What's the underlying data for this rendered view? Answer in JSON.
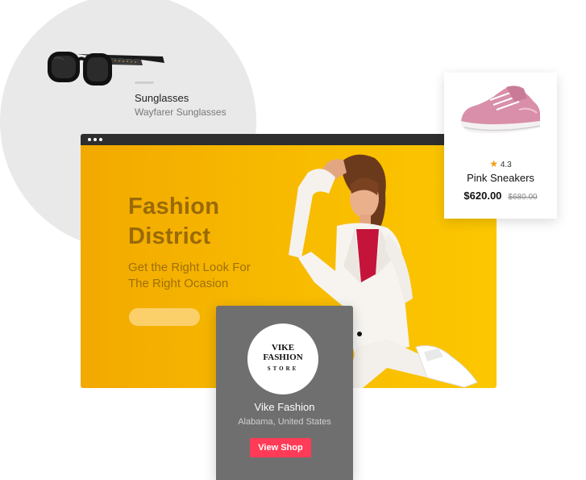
{
  "sunglasses_card": {
    "title": "Sunglasses",
    "subtitle": "Wayfarer Sunglasses"
  },
  "hero": {
    "title_line1": "Fashion",
    "title_line2": "District",
    "subtitle_line1": "Get the Right Look For",
    "subtitle_line2": "The Right Ocasion",
    "accent_color": "#f7b900"
  },
  "product_card": {
    "rating": "4.3",
    "title": "Pink Sneakers",
    "price": "$620.00",
    "old_price": "$680.00"
  },
  "store_card": {
    "logo_line1": "VIKE",
    "logo_line2": "FASHION",
    "logo_line3": "STORE",
    "name": "Vike Fashion",
    "location": "Alabama, United States",
    "button_label": "View Shop",
    "button_color": "#ff3b57"
  }
}
